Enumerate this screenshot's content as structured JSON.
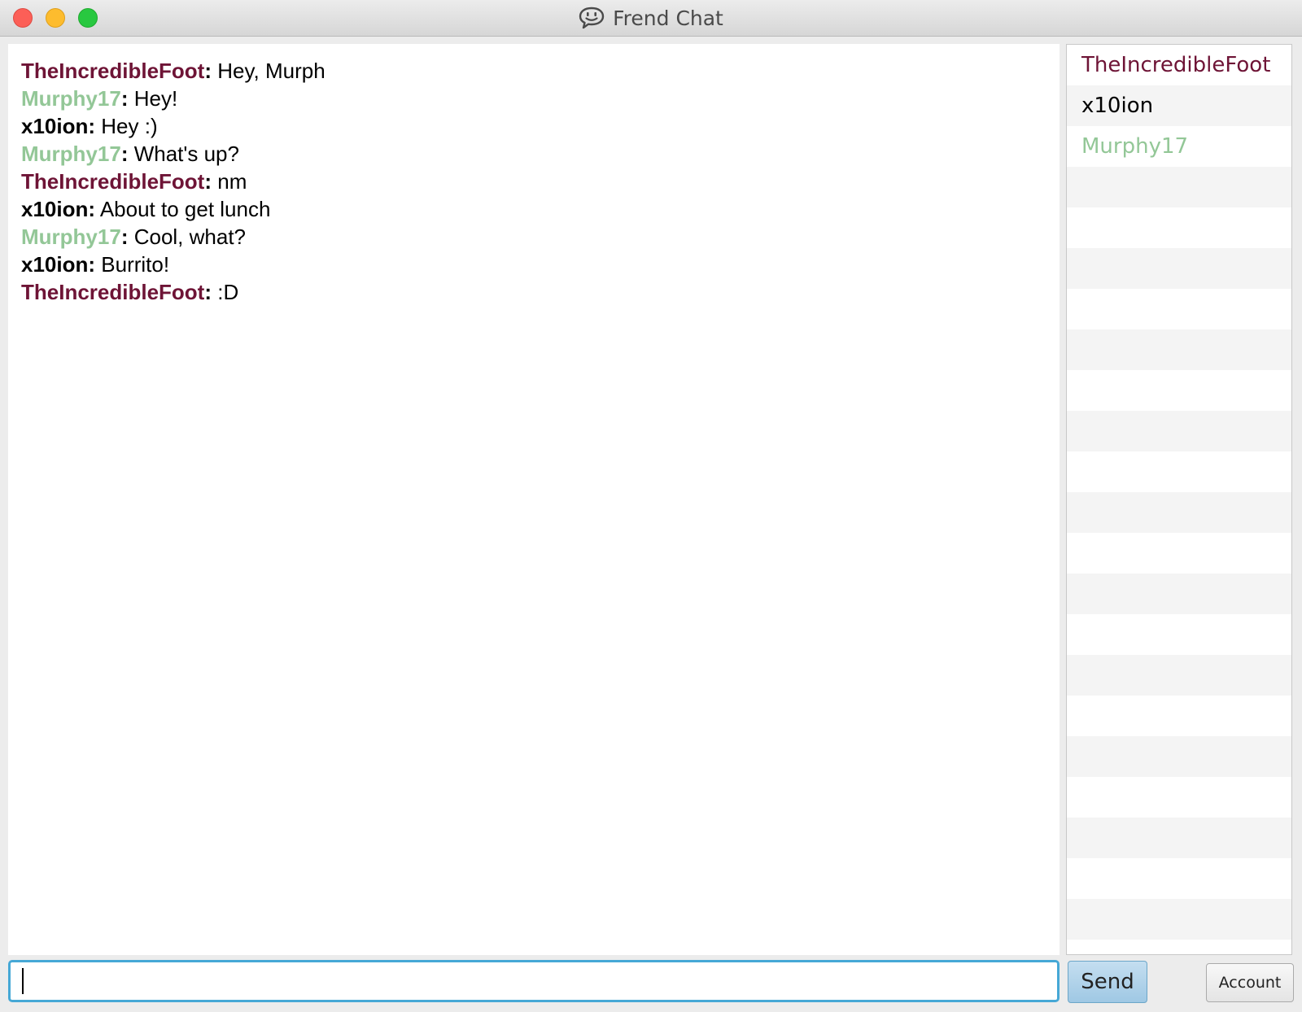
{
  "window": {
    "title": "Frend Chat",
    "icon": "chat-bubble-smile-icon"
  },
  "colors": {
    "TheIncredibleFoot": "#6e1436",
    "Murphy17": "#93c797",
    "x10ion": "#000000",
    "input_focus": "#46a8d6"
  },
  "messages": [
    {
      "user": "TheIncredibleFoot",
      "text": " Hey, Murph"
    },
    {
      "user": "Murphy17",
      "text": " Hey!"
    },
    {
      "user": "x10ion",
      "text": " Hey :)"
    },
    {
      "user": "Murphy17",
      "text": " What's up?"
    },
    {
      "user": "TheIncredibleFoot",
      "text": " nm"
    },
    {
      "user": "x10ion",
      "text": " About to get lunch"
    },
    {
      "user": "Murphy17",
      "text": " Cool, what?"
    },
    {
      "user": "x10ion",
      "text": " Burrito!"
    },
    {
      "user": "TheIncredibleFoot",
      "text": " :D"
    }
  ],
  "users": [
    {
      "name": "TheIncredibleFoot"
    },
    {
      "name": "x10ion"
    },
    {
      "name": "Murphy17"
    }
  ],
  "composer": {
    "value": "",
    "placeholder": ""
  },
  "buttons": {
    "send": "Send",
    "account": "Account"
  }
}
